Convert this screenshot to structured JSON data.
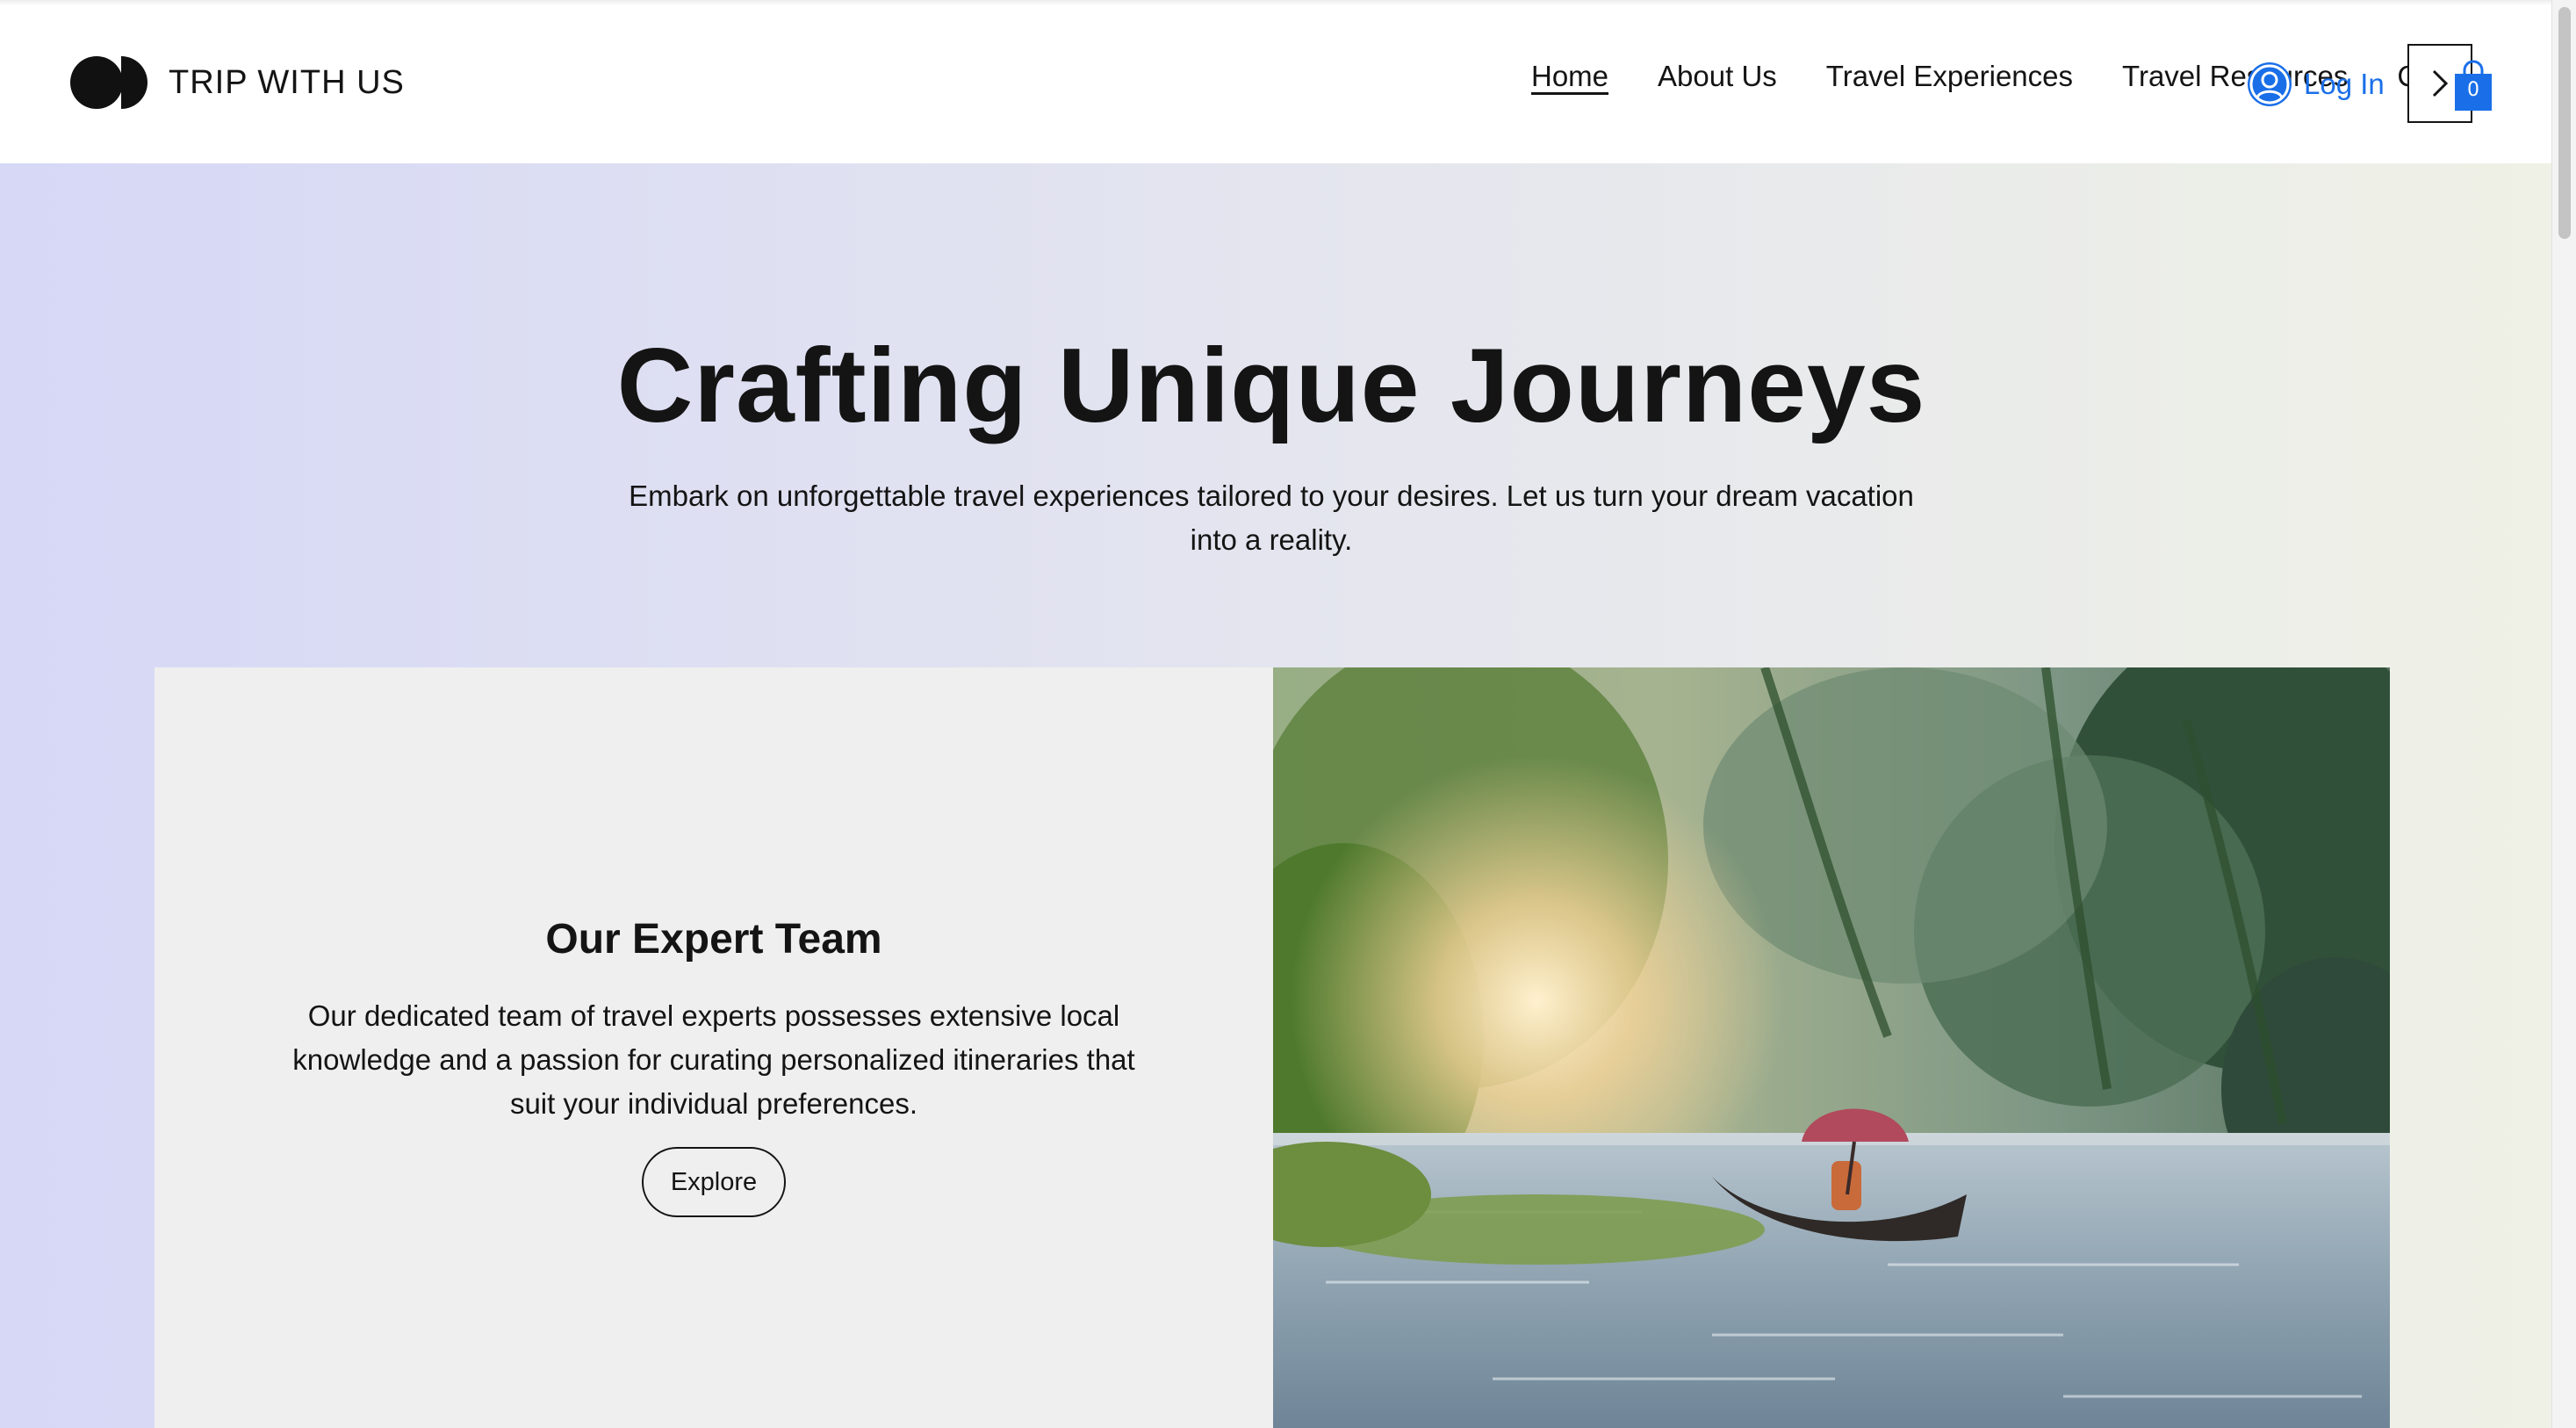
{
  "brand": {
    "name": "TRIP WITH US",
    "logo_icon": "logo-mark"
  },
  "nav": {
    "items": [
      {
        "label": "Home",
        "active": true
      },
      {
        "label": "About Us"
      },
      {
        "label": "Travel Experiences"
      },
      {
        "label": "Travel Resources"
      },
      {
        "label": "C"
      }
    ],
    "more_icon": "chevron-right-icon"
  },
  "account": {
    "login_label": "Log In",
    "icon": "user-avatar-icon"
  },
  "cart": {
    "count": "0",
    "icon": "shopping-bag-icon"
  },
  "hero": {
    "title": "Crafting Unique Journeys",
    "subtitle": "Embark on unforgettable travel experiences tailored to your desires. Let us turn your dream vacation into a reality."
  },
  "feature": {
    "title": "Our Expert Team",
    "text": "Our dedicated team of travel experts possesses extensive local knowledge and a passion for curating personalized itineraries that suit your individual preferences.",
    "button_label": "Explore",
    "image_subject": "backwater-canoe-photo"
  },
  "colors": {
    "accent": "#1a6fe8",
    "text": "#141414",
    "card_bg": "#efefef",
    "hero_gradient_start": "#d6d8f6",
    "hero_gradient_end": "#eff1e6"
  }
}
